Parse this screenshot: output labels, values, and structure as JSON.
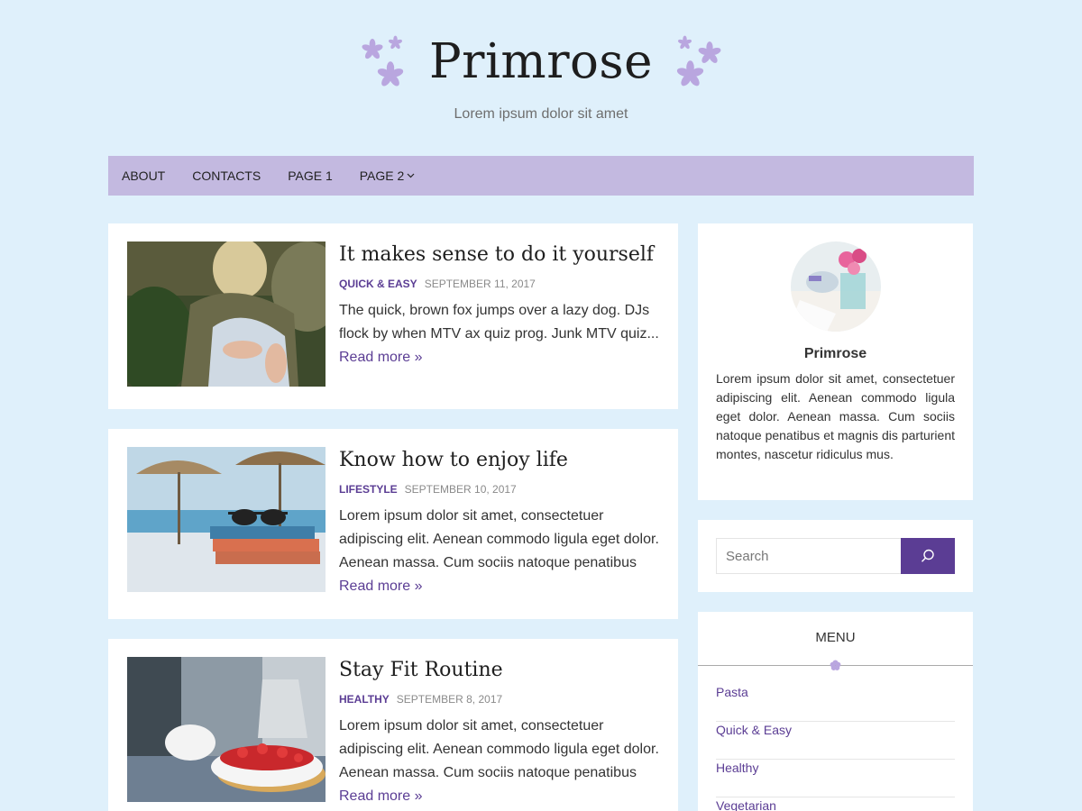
{
  "site": {
    "title": "Primrose",
    "tagline": "Lorem ipsum dolor sit amet"
  },
  "nav": {
    "items": [
      "ABOUT",
      "CONTACTS",
      "PAGE 1",
      "PAGE 2"
    ]
  },
  "posts": [
    {
      "title": "It makes sense to do it yourself",
      "category": "QUICK & EASY",
      "date": "SEPTEMBER 11, 2017",
      "excerpt": "The quick, brown fox jumps over a lazy dog. DJs flock by when MTV ax quiz prog. Junk MTV quiz...",
      "read_more": "Read more »"
    },
    {
      "title": "Know how to enjoy life",
      "category": "LIFESTYLE",
      "date": "SEPTEMBER 10, 2017",
      "excerpt": "Lorem ipsum dolor sit amet, consectetuer adipiscing elit. Aenean commodo ligula eget dolor. Aenean massa. Cum sociis natoque penatibus et...",
      "read_more": "Read more »"
    },
    {
      "title": "Stay Fit Routine",
      "category": "HEALTHY",
      "date": "SEPTEMBER 8, 2017",
      "excerpt": "Lorem ipsum dolor sit amet, consectetuer adipiscing elit. Aenean commodo ligula eget dolor. Aenean massa. Cum sociis natoque penatibus et...",
      "read_more": "Read more »"
    }
  ],
  "sidebar": {
    "about": {
      "name": "Primrose",
      "text": "Lorem ipsum dolor sit amet, consectetuer adipiscing elit. Aenean commodo ligula eget dolor. Aenean massa. Cum sociis natoque penatibus et magnis dis parturient montes, nascetur ridiculus mus."
    },
    "search": {
      "placeholder": "Search"
    },
    "menu": {
      "title": "MENU",
      "items": [
        "Pasta",
        "Quick & Easy",
        "Healthy",
        "Vegetarian"
      ]
    }
  },
  "colors": {
    "background": "#dff0fb",
    "nav": "#c3b9e0",
    "accent": "#5b3d94",
    "flower": "#b9a6df"
  },
  "icons": {
    "logo_decoration": "flower-icon",
    "search": "search-icon",
    "nav_dropdown": "chevron-down-icon"
  }
}
